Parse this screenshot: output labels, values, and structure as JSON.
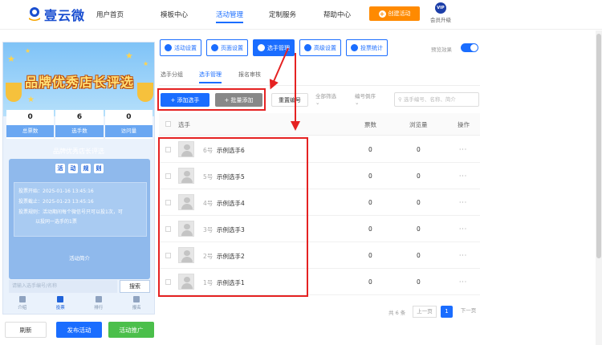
{
  "brand": {
    "name": "壹云微"
  },
  "nav": [
    {
      "label": "用户首页"
    },
    {
      "label": "模板中心"
    },
    {
      "label": "活动管理",
      "active": true
    },
    {
      "label": "定制服务"
    },
    {
      "label": "帮助中心"
    }
  ],
  "create_button": "创建活动",
  "vip": {
    "badge": "VIP",
    "label": "会员升级"
  },
  "preview": {
    "banner_title": "品牌优秀店长评选",
    "stats": [
      {
        "value": "0",
        "label": "总票数"
      },
      {
        "value": "6",
        "label": "选手数"
      },
      {
        "value": "0",
        "label": "访问量"
      }
    ],
    "activity_name": "品牌优秀店长评选",
    "rules_chars": [
      "活",
      "动",
      "规",
      "则"
    ],
    "info_lines": [
      "投票开始：2025-01-16 13:45:16",
      "投票截止：2025-01-23 13:45:16",
      "投票规则：活动期间每个微信号只可以投1次，可",
      "以投同一选手的1票"
    ],
    "intro_label": "活动简介",
    "search_placeholder": "请输入选手编号/名称",
    "search_button": "搜索",
    "bottom_nav": [
      {
        "label": "介绍"
      },
      {
        "label": "投票",
        "active": true
      },
      {
        "label": "排行"
      },
      {
        "label": "报名"
      }
    ]
  },
  "bottom_buttons": {
    "refresh": "刷新",
    "publish": "发布活动",
    "promote": "活动推广"
  },
  "toolbar": [
    {
      "label": "活动设置"
    },
    {
      "label": "页面设置"
    },
    {
      "label": "选手管理",
      "active": true
    },
    {
      "label": "高级设置"
    },
    {
      "label": "投票统计"
    }
  ],
  "preview_toggle_label": "预览效果",
  "preview_toggle_on": true,
  "subtabs": [
    {
      "label": "选手分组"
    },
    {
      "label": "选手管理",
      "active": true
    },
    {
      "label": "报名审核"
    }
  ],
  "actions": {
    "add": "+ 添加选手",
    "batch_add": "+ 批量添加",
    "reset_no": "重置编号",
    "filter_all": "全部筛选",
    "sort": "编号倒序",
    "search_placeholder": "选手编号、名称、简介"
  },
  "table": {
    "headers": {
      "contestant": "选手",
      "votes": "票数",
      "views": "浏览量",
      "ops": "操作"
    },
    "rows": [
      {
        "no": "6号",
        "name": "示例选手6",
        "votes": "0",
        "views": "0",
        "ops": "···"
      },
      {
        "no": "5号",
        "name": "示例选手5",
        "votes": "0",
        "views": "0",
        "ops": "···"
      },
      {
        "no": "4号",
        "name": "示例选手4",
        "votes": "0",
        "views": "0",
        "ops": "···"
      },
      {
        "no": "3号",
        "name": "示例选手3",
        "votes": "0",
        "views": "0",
        "ops": "···"
      },
      {
        "no": "2号",
        "name": "示例选手2",
        "votes": "0",
        "views": "0",
        "ops": "···"
      },
      {
        "no": "1号",
        "name": "示例选手1",
        "votes": "0",
        "views": "0",
        "ops": "···"
      }
    ]
  },
  "pagination": {
    "total": "共 6 条",
    "prev": "上一页",
    "current": "1",
    "next": "下一页"
  },
  "colors": {
    "accent": "#1a6dff",
    "highlight": "#e52222",
    "create": "#ff8a00",
    "promote": "#4bbf4b"
  },
  "chart_data": {
    "type": "table",
    "columns": [
      "选手",
      "票数",
      "浏览量"
    ],
    "rows": [
      [
        "6号 示例选手6",
        0,
        0
      ],
      [
        "5号 示例选手5",
        0,
        0
      ],
      [
        "4号 示例选手4",
        0,
        0
      ],
      [
        "3号 示例选手3",
        0,
        0
      ],
      [
        "2号 示例选手2",
        0,
        0
      ],
      [
        "1号 示例选手1",
        0,
        0
      ]
    ]
  }
}
